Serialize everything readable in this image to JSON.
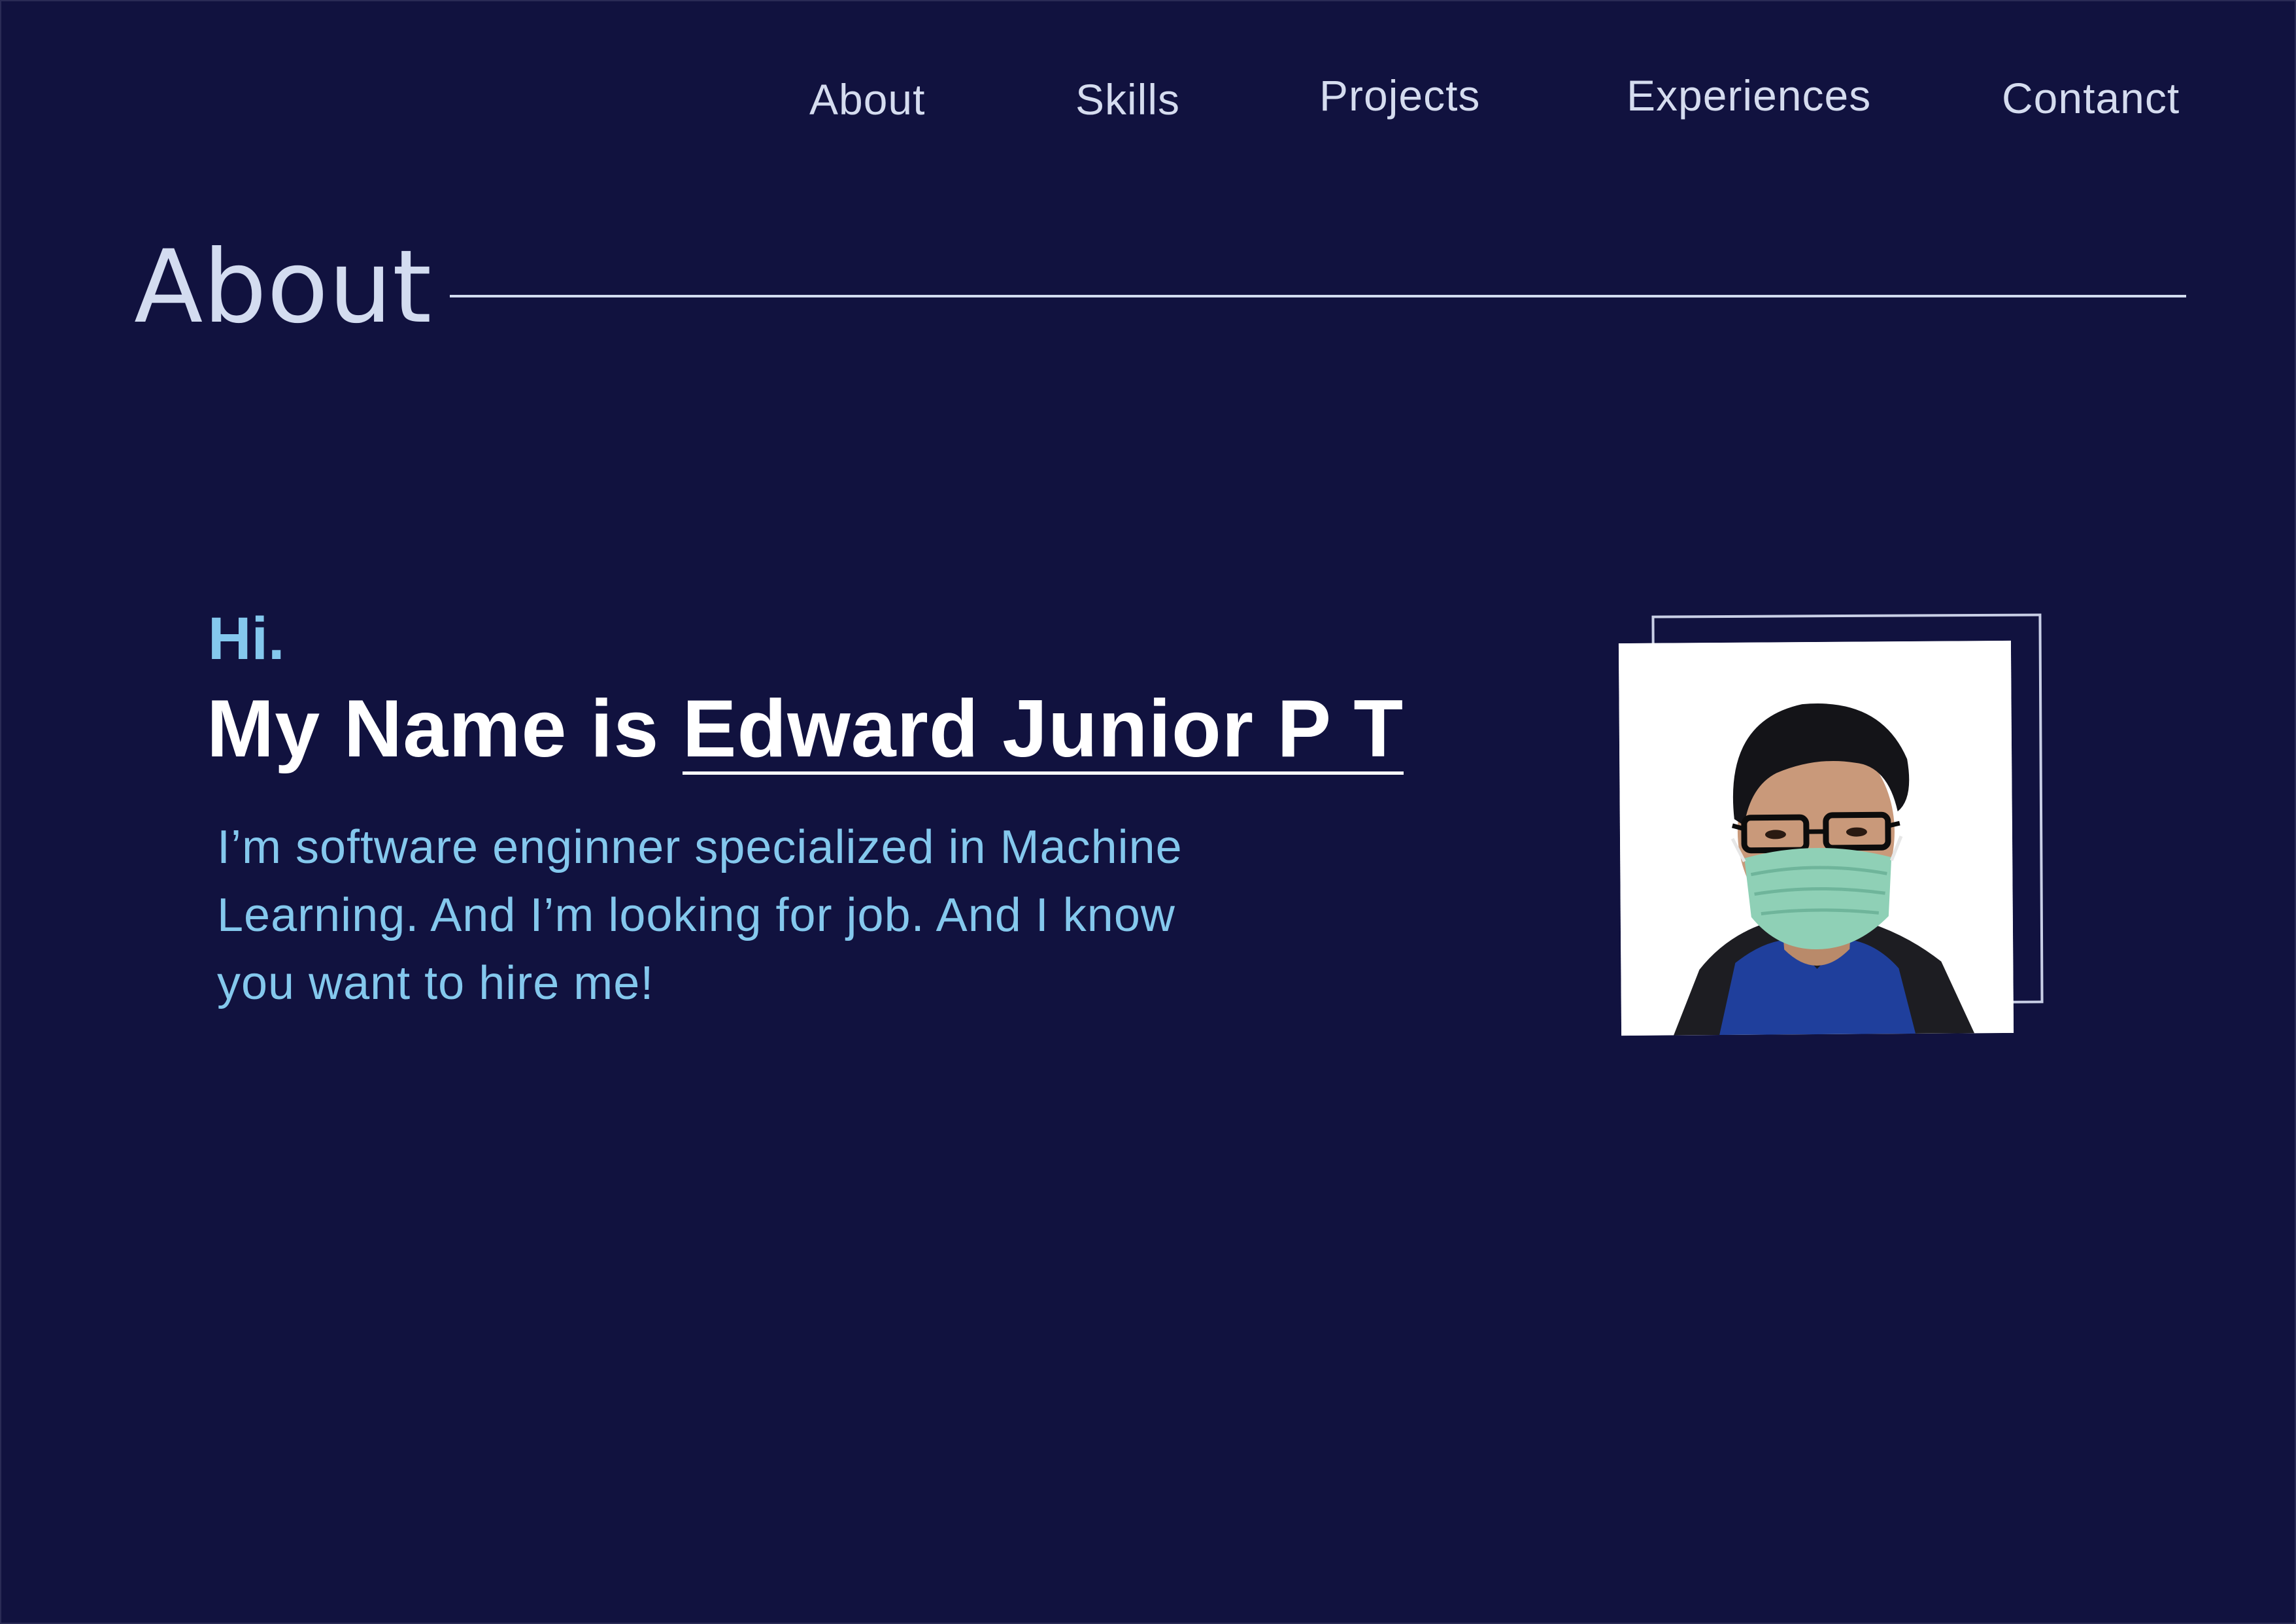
{
  "nav": {
    "items": [
      {
        "label": "About"
      },
      {
        "label": "Skills"
      },
      {
        "label": "Projects"
      },
      {
        "label": "Experiences"
      },
      {
        "label": "Contanct"
      }
    ]
  },
  "section": {
    "title": "About"
  },
  "intro": {
    "greeting": "Hi.",
    "name_prefix": "My Name is",
    "name": "Edward Junior P T",
    "bio": "I’m software enginner specialized in Machine Learning. And I’m looking for job. And I know you want to hire me!"
  },
  "colors": {
    "background": "#11123f",
    "nav_text": "#d5dcef",
    "accent": "#84c8ed",
    "heading": "#ffffff"
  },
  "icons": {
    "profile_photo": "profile-photo-icon"
  }
}
